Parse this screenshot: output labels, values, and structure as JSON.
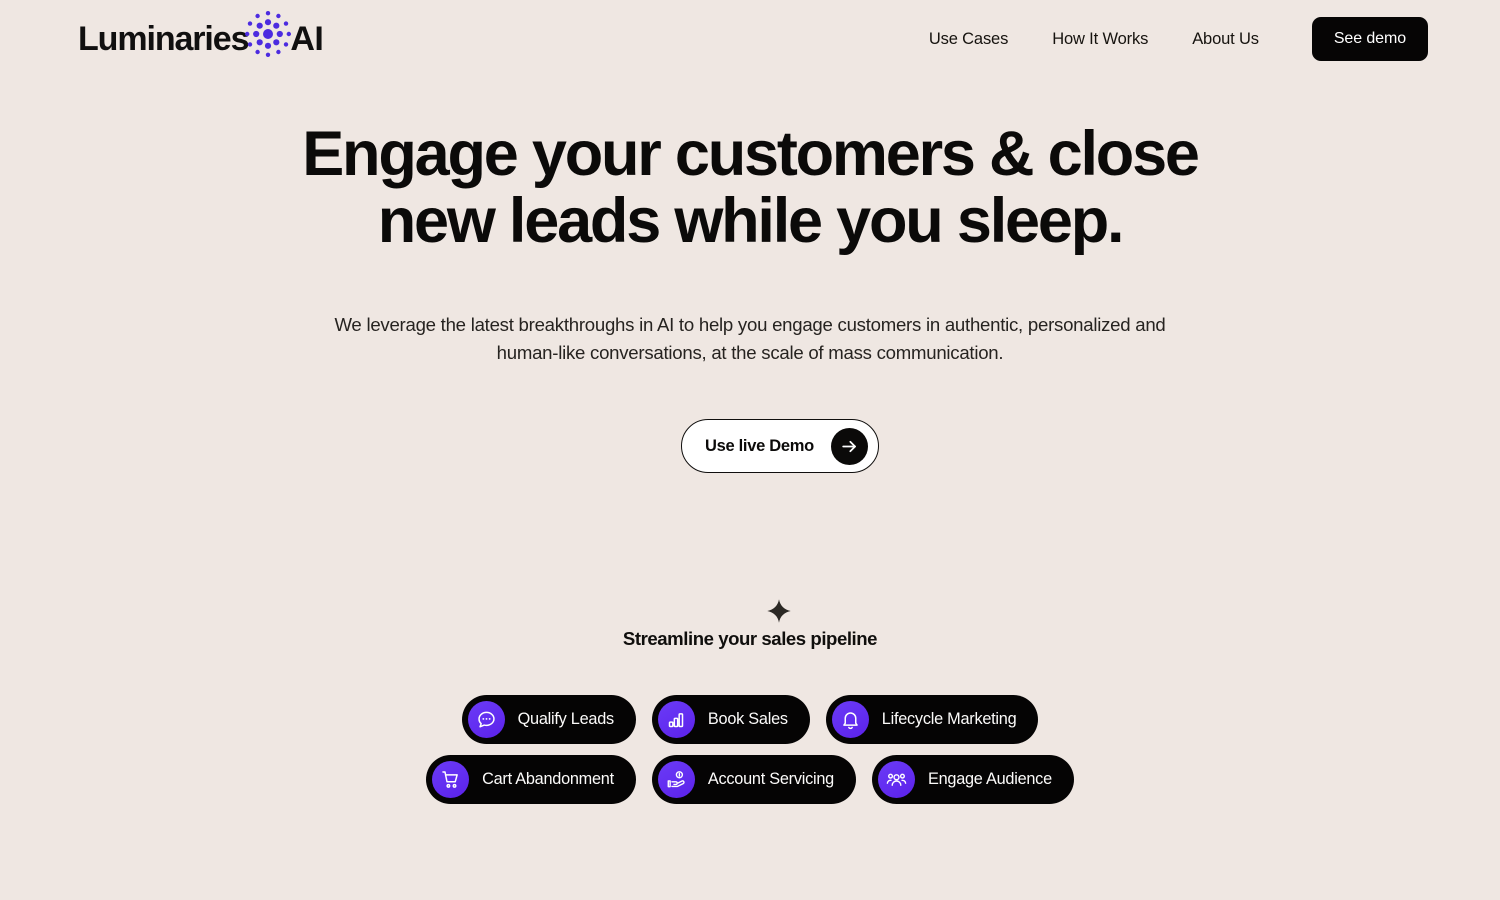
{
  "brand": {
    "name_main": "Luminaries",
    "name_suffix": "AI",
    "mark_icon": "radial-dot-cluster-icon",
    "mark_color": "#4C2BE0"
  },
  "header": {
    "nav_links": [
      {
        "label": "Use Cases"
      },
      {
        "label": "How It Works"
      },
      {
        "label": "About Us"
      }
    ],
    "cta": {
      "label": "See demo",
      "bg_color": "#060505",
      "text_color": "#FFFFFF"
    }
  },
  "hero": {
    "headline": "Engage your customers & close new leads while you sleep.",
    "subheadline": "We leverage the latest breakthroughs in AI to help you engage customers in authentic, personalized and human-like conversations, at the scale of mass communication.",
    "cta": {
      "label": "Use live Demo",
      "icon": "arrow-right-icon",
      "bg_color": "#FFFFFF",
      "border_color": "#100F0E"
    }
  },
  "pipeline": {
    "badge_icon": "sparkle-icon",
    "title": "Streamline your sales pipeline",
    "rows": [
      [
        {
          "label": "Qualify Leads",
          "icon": "chat-bubble-icon"
        },
        {
          "label": "Book Sales",
          "icon": "bar-chart-icon"
        },
        {
          "label": "Lifecycle Marketing",
          "icon": "bell-icon"
        }
      ],
      [
        {
          "label": "Cart Abandonment",
          "icon": "shopping-cart-icon"
        },
        {
          "label": "Account Servicing",
          "icon": "hand-coin-icon"
        },
        {
          "label": "Engage Audience",
          "icon": "users-group-icon"
        }
      ]
    ]
  },
  "theme": {
    "background": "#EFE7E2",
    "accent_purple": "#6430F2",
    "ink": "#0B0A09"
  }
}
